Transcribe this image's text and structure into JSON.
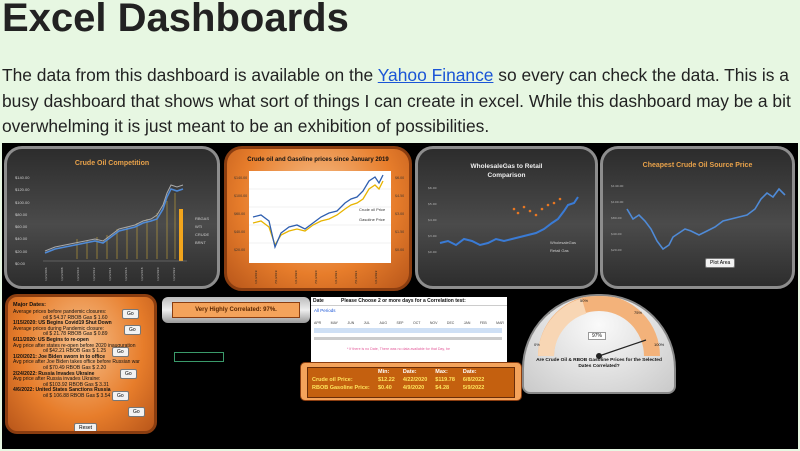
{
  "page": {
    "title": "Excel Dashboards",
    "intro_before": "The data from this dashboard is available on the ",
    "intro_link": "Yahoo Finance",
    "intro_after": " so every can check the data. This is a busy dashboard that shows what sort of things I can create in excel. While this dashboard may be a bit overwhelming it is just meant to be an exhibition of possibilities."
  },
  "dashboard": {
    "crude_title": "Crude Oil Competition",
    "crude_legend": [
      "RBGAS",
      "WTI",
      "CRUDE",
      "BRNT"
    ],
    "crude_yticks": [
      "$140.00",
      "$120.00",
      "$100.00",
      "$80.00",
      "$60.00",
      "$40.00",
      "$20.00",
      "$0.00"
    ],
    "gas_title": "Crude oil and Gasoline prices since January 2019",
    "gas_legend": [
      "Crude oil Price",
      "Gasoline Price"
    ],
    "wholesale_title": "WholesaleGas to Retail Comparison",
    "wholesale_legend": [
      "WholesaleGas",
      "Retail Gas"
    ],
    "cheapest_title": "Cheapest Crude Oil Source Price",
    "cheapest_button": "Plot Area",
    "major_dates": {
      "title": "Major Dates:",
      "go": "Go",
      "reset": "Reset",
      "items": [
        {
          "text": "Average prices before pandemic closures:",
          "sub": "oil $ 54.37 RBOB Gas $ 1.60"
        },
        {
          "text": "1/15/2020: US Begins Covid19 Shut Down",
          "sub": "Average prices during Pandemic closure:"
        },
        {
          "text": "oil $ 21.78 RBOB Gas $ 0.89",
          "sub": ""
        },
        {
          "text": "6/11/2020: US Begins to re-open",
          "sub": "Avg price after states re-open before 2020 inauguration"
        },
        {
          "text": "oil $42.21 RBOB Gas $ 1.25",
          "sub": ""
        },
        {
          "text": "1/20/2021: Joe Biden sworn in to office",
          "sub": "Avg price after Joe Biden takes office before Russian war"
        },
        {
          "text": "oil $70.49 RBOB Gas $ 2.20",
          "sub": ""
        },
        {
          "text": "2/24/2022: Russia Invades Ukraine",
          "sub": "Avg price after Russia invades Ukraine:"
        },
        {
          "text": "oil $103.92 RBOB Gas $ 3.31",
          "sub": ""
        },
        {
          "text": "4/6/2022: United States Sanctions Russia",
          "sub": "oil $ 106.88 RBOB Gas $ 3.54"
        }
      ]
    },
    "correlation_label": "Very Highly Correlated: 97%.",
    "date_header": "Date",
    "date_instruction": "Please Choose 2 or more days for a Correlation test:",
    "all_periods": "All Periods",
    "months": [
      "APR",
      "MAY",
      "JUN",
      "JUL",
      "AUG",
      "SEP",
      "OCT",
      "NOV",
      "DEC",
      "JAN",
      "FEB",
      "MAR"
    ],
    "no_data_note": "* If there is no Date, There was no data available for that Day, be",
    "stats": {
      "headers": [
        "",
        "Min:",
        "Date:",
        "Max:",
        "Date:"
      ],
      "rows": [
        [
          "Crude oil Price:",
          "$12.22",
          "4/22/2020",
          "$119.78",
          "6/8/2022"
        ],
        [
          "RBOB Gasoline Price:",
          "$0.40",
          "4/9/2020",
          "$4.28",
          "5/9/2022"
        ]
      ]
    },
    "gauge": {
      "value": 0.97,
      "center_label": "97%",
      "labels": [
        "0%",
        "25%",
        "50%",
        "75%",
        "100%"
      ],
      "question": "Are Crude Oil & RBOB Gasoline Prices for the Selected Dates Correlated?"
    }
  }
}
